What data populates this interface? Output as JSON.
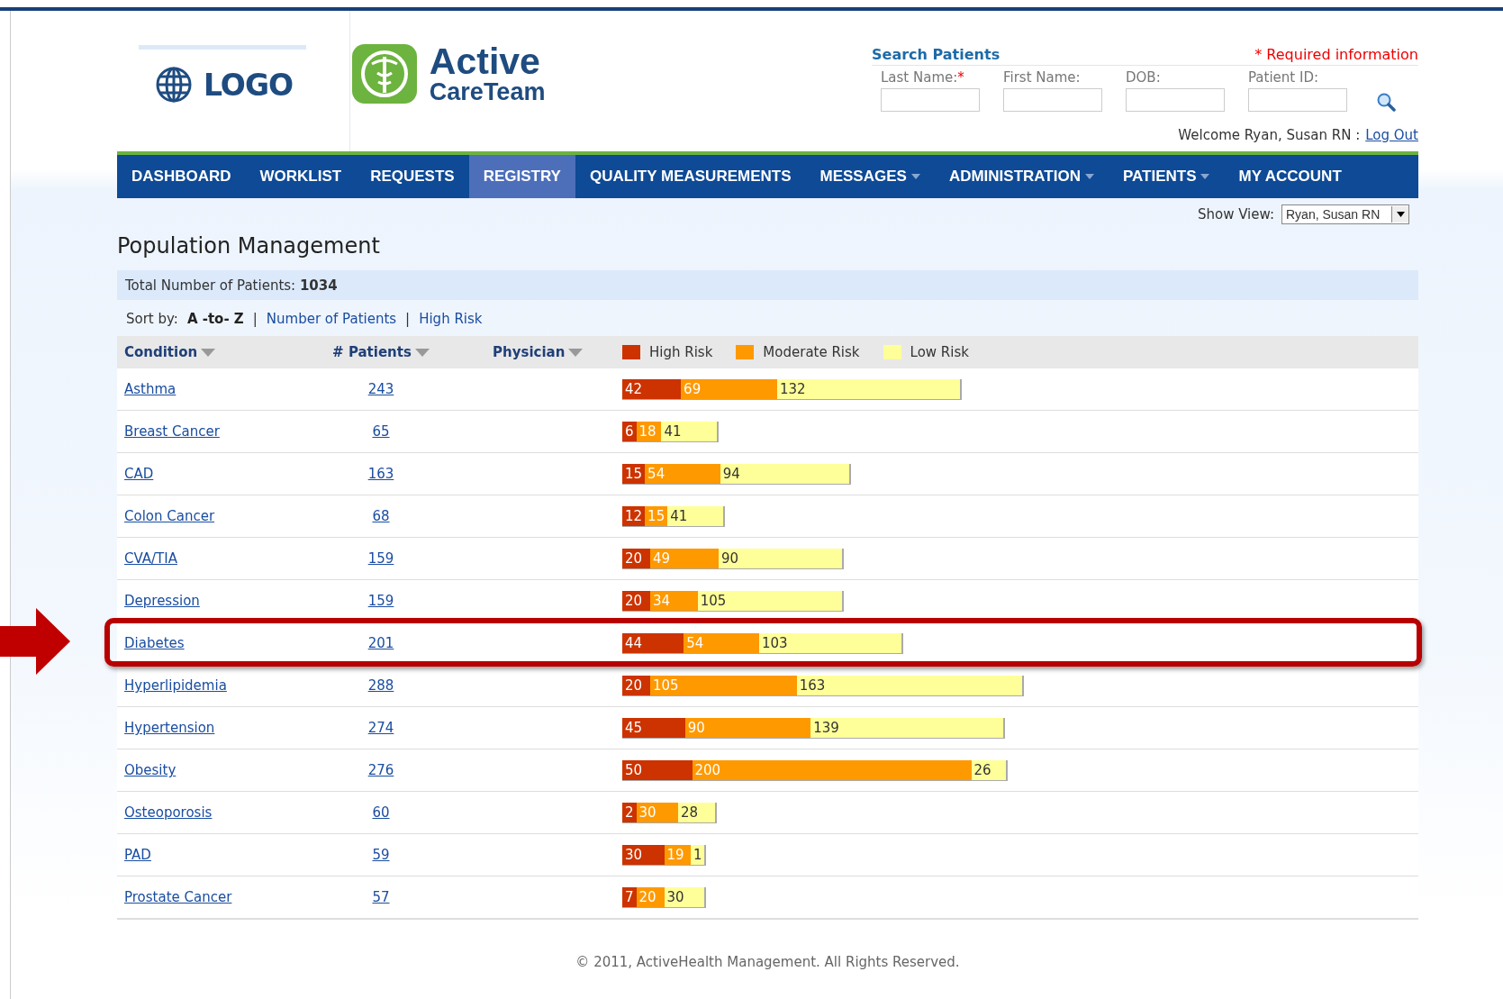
{
  "header": {
    "logo_text": "LOGO",
    "brand_line1": "Active",
    "brand_line2": "CareTeam"
  },
  "search": {
    "title": "Search Patients",
    "required_note": "* Required information",
    "fields": [
      {
        "label": "Last Name:",
        "required_mark": "*"
      },
      {
        "label": "First Name:"
      },
      {
        "label": "DOB:"
      },
      {
        "label": "Patient ID:"
      }
    ],
    "welcome": "Welcome Ryan, Susan RN :",
    "logout": "Log Out"
  },
  "nav": [
    {
      "label": "DASHBOARD",
      "selected": false,
      "has_menu": false
    },
    {
      "label": "WORKLIST",
      "selected": false,
      "has_menu": false
    },
    {
      "label": "REQUESTS",
      "selected": false,
      "has_menu": false
    },
    {
      "label": "REGISTRY",
      "selected": true,
      "has_menu": false
    },
    {
      "label": "QUALITY MEASUREMENTS",
      "selected": false,
      "has_menu": false
    },
    {
      "label": "MESSAGES",
      "selected": false,
      "has_menu": true
    },
    {
      "label": "ADMINISTRATION",
      "selected": false,
      "has_menu": true
    },
    {
      "label": "PATIENTS",
      "selected": false,
      "has_menu": true
    },
    {
      "label": "MY ACCOUNT",
      "selected": false,
      "has_menu": false
    }
  ],
  "show_view": {
    "label": "Show View:",
    "value": "Ryan, Susan RN"
  },
  "title": "Population Management",
  "total": {
    "label": "Total Number of Patients:",
    "value": "1034"
  },
  "sort": {
    "label": "Sort by:",
    "options": [
      {
        "label": "A -to- Z",
        "selected": true
      },
      {
        "separator": "|",
        "label": "Number of Patients",
        "selected": false
      },
      {
        "separator": "|",
        "label": "High Risk",
        "selected": false
      }
    ]
  },
  "columns": [
    "Condition",
    "# Patients",
    "Physician"
  ],
  "legend": [
    {
      "label": "High Risk",
      "kind": "high"
    },
    {
      "label": "Moderate Risk",
      "kind": "moderate"
    },
    {
      "label": "Low Risk",
      "kind": "low"
    }
  ],
  "rows": [
    {
      "condition": "Asthma",
      "patients": "243",
      "callout": false,
      "segments": [
        {
          "kind": "high",
          "value": "42"
        },
        {
          "kind": "moderate",
          "value": "69"
        },
        {
          "kind": "low",
          "value": "132"
        }
      ]
    },
    {
      "condition": "Breast Cancer",
      "patients": "65",
      "callout": false,
      "segments": [
        {
          "kind": "high",
          "value": "6"
        },
        {
          "kind": "moderate",
          "value": "18"
        },
        {
          "kind": "low",
          "value": "41"
        }
      ]
    },
    {
      "condition": "CAD",
      "patients": "163",
      "callout": false,
      "segments": [
        {
          "kind": "high",
          "value": "15"
        },
        {
          "kind": "moderate",
          "value": "54"
        },
        {
          "kind": "low",
          "value": "94"
        }
      ]
    },
    {
      "condition": "Colon Cancer",
      "patients": "68",
      "callout": false,
      "segments": [
        {
          "kind": "high",
          "value": "12"
        },
        {
          "kind": "moderate",
          "value": "15"
        },
        {
          "kind": "low",
          "value": "41"
        }
      ]
    },
    {
      "condition": "CVA/TIA",
      "patients": "159",
      "callout": false,
      "segments": [
        {
          "kind": "high",
          "value": "20"
        },
        {
          "kind": "moderate",
          "value": "49"
        },
        {
          "kind": "low",
          "value": "90"
        }
      ]
    },
    {
      "condition": "Depression",
      "patients": "159",
      "callout": false,
      "segments": [
        {
          "kind": "high",
          "value": "20"
        },
        {
          "kind": "moderate",
          "value": "34"
        },
        {
          "kind": "low",
          "value": "105"
        }
      ]
    },
    {
      "condition": "Diabetes",
      "patients": "201",
      "callout": true,
      "segments": [
        {
          "kind": "high",
          "value": "44"
        },
        {
          "kind": "moderate",
          "value": "54"
        },
        {
          "kind": "low",
          "value": "103"
        }
      ]
    },
    {
      "condition": "Hyperlipidemia",
      "patients": "288",
      "callout": false,
      "segments": [
        {
          "kind": "high",
          "value": "20"
        },
        {
          "kind": "moderate",
          "value": "105"
        },
        {
          "kind": "low",
          "value": "163"
        }
      ]
    },
    {
      "condition": "Hypertension",
      "patients": "274",
      "callout": false,
      "segments": [
        {
          "kind": "high",
          "value": "45"
        },
        {
          "kind": "moderate",
          "value": "90"
        },
        {
          "kind": "low",
          "value": "139"
        }
      ]
    },
    {
      "condition": "Obesity",
      "patients": "276",
      "callout": false,
      "segments": [
        {
          "kind": "high",
          "value": "50"
        },
        {
          "kind": "moderate",
          "value": "200"
        },
        {
          "kind": "low",
          "value": "26"
        }
      ]
    },
    {
      "condition": "Osteoporosis",
      "patients": "60",
      "callout": false,
      "segments": [
        {
          "kind": "high",
          "value": "2"
        },
        {
          "kind": "moderate",
          "value": "30"
        },
        {
          "kind": "low",
          "value": "28"
        }
      ]
    },
    {
      "condition": "PAD",
      "patients": "59",
      "callout": false,
      "segments": [
        {
          "kind": "high",
          "value": "30"
        },
        {
          "kind": "moderate",
          "value": "19"
        },
        {
          "kind": "low",
          "value": "1"
        }
      ]
    },
    {
      "condition": "Prostate Cancer",
      "patients": "57",
      "callout": false,
      "segments": [
        {
          "kind": "high",
          "value": "7"
        },
        {
          "kind": "moderate",
          "value": "20"
        },
        {
          "kind": "low",
          "value": "30"
        }
      ]
    }
  ],
  "footer": "© 2011, ActiveHealth Management. All Rights Reserved."
}
